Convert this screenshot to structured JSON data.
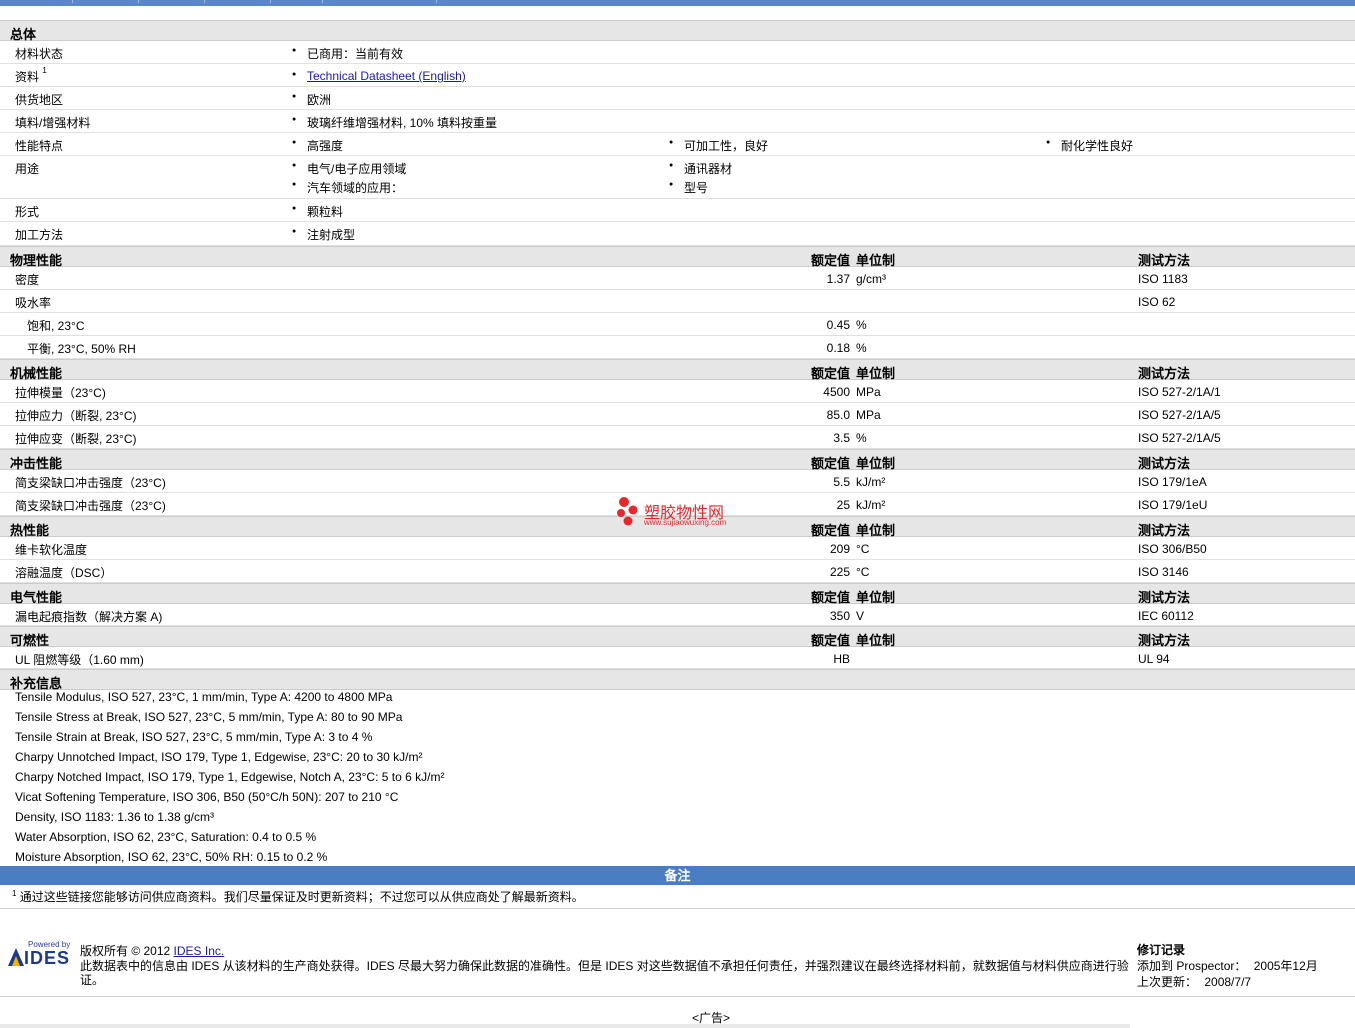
{
  "general": {
    "heading": "总体",
    "rows": [
      {
        "label": "材料状态",
        "v1": "已商用：当前有效"
      },
      {
        "label": "资料",
        "sup": "1",
        "link": "Technical Datasheet (English)"
      },
      {
        "label": "供货地区",
        "v1": "欧洲"
      },
      {
        "label": "填料/增强材料",
        "v1": "玻璃纤维增强材料, 10% 填料按重量"
      },
      {
        "label": "性能特点",
        "v1": "高强度",
        "v2": "可加工性，良好",
        "v3": "耐化学性良好"
      },
      {
        "label": "用途",
        "v1": "电气/电子应用领域",
        "v2": "通讯器材",
        "v1b": "汽车领域的应用：",
        "v2b": "型号"
      },
      {
        "label": "形式",
        "v1": "颗粒料"
      },
      {
        "label": "加工方法",
        "v1": "注射成型"
      }
    ]
  },
  "headers": {
    "value": "额定值",
    "unit": "单位制",
    "method": "测试方法"
  },
  "physical": {
    "heading": "物理性能",
    "rows": [
      {
        "label": "密度",
        "value": "1.37",
        "unit": "g/cm³",
        "method": "ISO 1183"
      },
      {
        "label": "吸水率",
        "value": "",
        "unit": "",
        "method": "ISO 62"
      },
      {
        "label": "饱和, 23°C",
        "value": "0.45",
        "unit": "%",
        "method": ""
      },
      {
        "label": "平衡, 23°C, 50% RH",
        "value": "0.18",
        "unit": "%",
        "method": ""
      }
    ]
  },
  "mechanical": {
    "heading": "机械性能",
    "rows": [
      {
        "label": "拉伸模量（23°C)",
        "value": "4500",
        "unit": "MPa",
        "method": "ISO 527-2/1A/1"
      },
      {
        "label": "拉伸应力（断裂, 23°C)",
        "value": "85.0",
        "unit": "MPa",
        "method": "ISO 527-2/1A/5"
      },
      {
        "label": "拉伸应变（断裂, 23°C)",
        "value": "3.5",
        "unit": "%",
        "method": "ISO 527-2/1A/5"
      }
    ]
  },
  "impact": {
    "heading": "冲击性能",
    "rows": [
      {
        "label": "简支梁缺口冲击强度（23°C)",
        "value": "5.5",
        "unit": "kJ/m²",
        "method": "ISO 179/1eA"
      },
      {
        "label": "简支梁缺口冲击强度（23°C)",
        "value": "25",
        "unit": "kJ/m²",
        "method": "ISO 179/1eU"
      }
    ]
  },
  "thermal": {
    "heading": "热性能",
    "rows": [
      {
        "label": "维卡软化温度",
        "value": "209",
        "unit": "°C",
        "method": "ISO 306/B50"
      },
      {
        "label": "溶融温度（DSC）",
        "value": "225",
        "unit": "°C",
        "method": "ISO 3146"
      }
    ]
  },
  "electrical": {
    "heading": "电气性能",
    "rows": [
      {
        "label": "漏电起痕指数（解决方案 A)",
        "value": "350",
        "unit": "V",
        "method": "IEC 60112"
      }
    ]
  },
  "flammability": {
    "heading": "可燃性",
    "rows": [
      {
        "label": "UL 阻燃等级（1.60 mm)",
        "value": "HB",
        "unit": "",
        "method": "UL 94"
      }
    ]
  },
  "supplement": {
    "heading": "补充信息",
    "lines": [
      "Tensile Modulus, ISO 527, 23°C, 1 mm/min, Type A: 4200 to 4800 MPa",
      "Tensile Stress at Break, ISO 527, 23°C, 5 mm/min, Type A: 80 to 90 MPa",
      "Tensile Strain at Break, ISO 527, 23°C, 5 mm/min, Type A: 3 to 4 %",
      "Charpy Unnotched Impact, ISO 179, Type 1, Edgewise, 23°C: 20 to 30 kJ/m²",
      "Charpy Notched Impact, ISO 179, Type 1, Edgewise, Notch A, 23°C: 5 to 6 kJ/m²",
      "Vicat Softening Temperature, ISO 306, B50 (50°C/h 50N): 207 to 210 °C",
      "Density, ISO 1183: 1.36 to 1.38 g/cm³",
      "Water Absorption, ISO 62, 23°C, Saturation: 0.4 to 0.5 %",
      "Moisture Absorption, ISO 62, 23°C, 50% RH: 0.15 to 0.2 %"
    ]
  },
  "notes": {
    "heading": "备注",
    "sup": "1",
    "text": "通过这些链接您能够访问供应商资料。我们尽量保证及时更新资料；不过您可以从供应商处了解最新资料。"
  },
  "footer": {
    "logo_small": "Powered by",
    "logo_text": "IDES",
    "copyright_prefix": "版权所有 © 2012 ",
    "copyright_link": "IDES Inc.",
    "disclaimer_line1": "此数据表中的信息由 IDES 从该材料的生产商处获得。IDES 尽最大努力确保此数据的准确性。但是 IDES 对这些数据值不承担任何责任，并强烈建议在最终选择材料前，就数据值与材料供应商进行验",
    "disclaimer_line2": "证。",
    "revision_title": "修订记录",
    "added_label": "添加到 Prospector：",
    "added_value": "2005年12月",
    "updated_label": "上次更新：",
    "updated_value": "2008/7/7",
    "ad": "<广告>"
  },
  "watermark": {
    "title": "塑胶物性网",
    "url": "www.sujiaowuxing.com",
    "color": "#e8262b"
  }
}
